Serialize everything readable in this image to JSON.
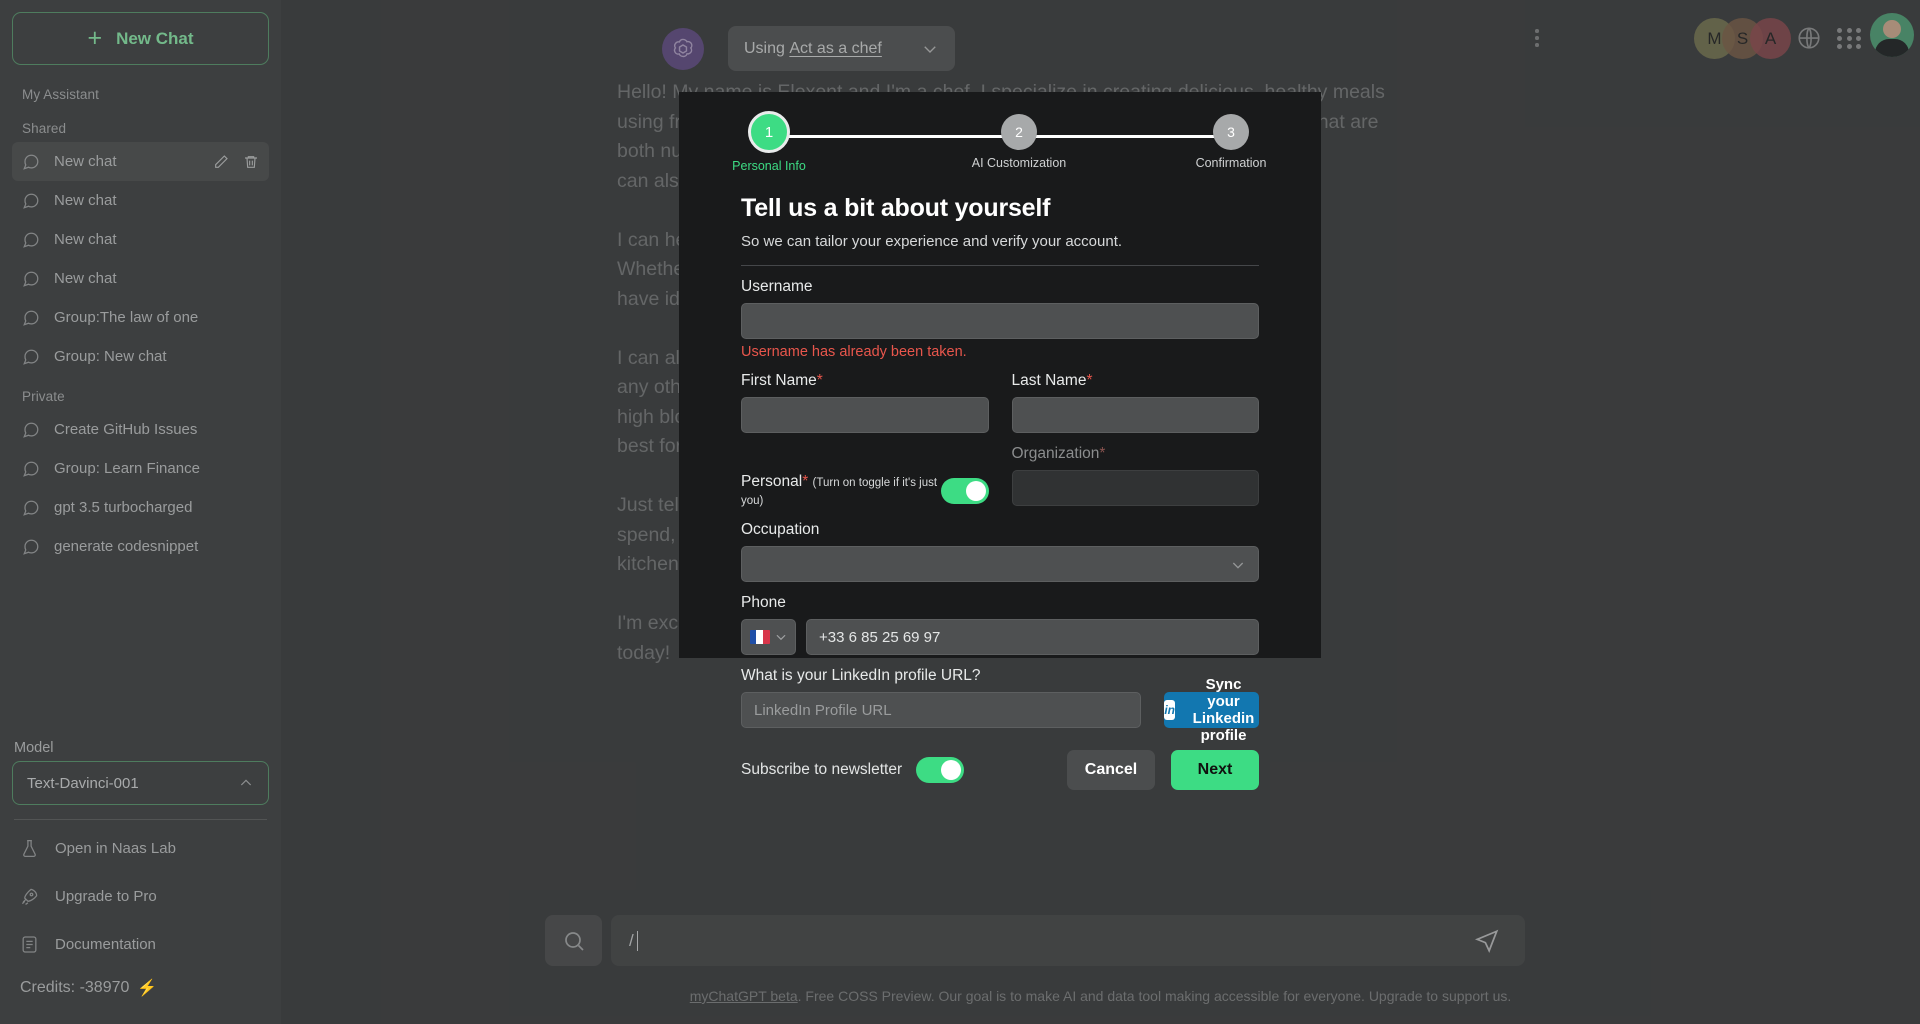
{
  "sidebar": {
    "new_chat_label": "New Chat",
    "sections": [
      {
        "label": "My Assistant"
      },
      {
        "label": "Shared"
      },
      {
        "label": "Private"
      }
    ],
    "shared_chats": [
      {
        "title": "New chat",
        "active": true
      },
      {
        "title": "New chat",
        "active": false
      },
      {
        "title": "New chat",
        "active": false
      },
      {
        "title": "New chat",
        "active": false
      },
      {
        "title": "Group:The law of one",
        "active": false
      },
      {
        "title": "Group: New chat",
        "active": false
      }
    ],
    "private_chats": [
      {
        "title": "Create GitHub Issues"
      },
      {
        "title": "Group: Learn Finance"
      },
      {
        "title": "gpt 3.5 turbocharged"
      },
      {
        "title": "generate codesnippet"
      }
    ],
    "model_label": "Model",
    "model_value": "Text-Davinci-001",
    "links": [
      {
        "label": "Open in Naas Lab",
        "icon": "flask-icon"
      },
      {
        "label": "Upgrade to Pro",
        "icon": "rocket-icon"
      },
      {
        "label": "Documentation",
        "icon": "document-icon"
      }
    ],
    "credits_label": "Credits: -38970"
  },
  "topbar": {
    "using_prefix": "Using",
    "using_value": "Act as a chef",
    "avatars": [
      {
        "initial": "M",
        "color": "#8a8a62"
      },
      {
        "initial": "S",
        "color": "#8a6d57"
      },
      {
        "initial": "A",
        "color": "#9c5a5f"
      }
    ]
  },
  "background_chat": {
    "text": "Hello! My name is Elexent and I'm a chef. I specialize in creating delicious, healthy meals\nusing fresh, locally sourced ingredients. I'm passionate about finding ingredients that are\nboth nutritious and flavorful, and I love helping people discover how healthy food\ncan also taste amazing.\n\nI can help you plan meals, suggest recipes, and advise on your dietary habits.\nWhether you need a quick weeknight dinner or a full week of prep, I\nhave ideas that fit your schedule, your budget, and your taste.\n\nI can also adapt recipes for allergies, vegetarian or vegan diets, or\nany other restrictions you may have. If you're managing diabetes,\nhigh blood pressure, or cholesterol, I can tailor suggestions to what's\nbest for you.\n\nJust tell me what ingredients you have on hand and what you can\nspend, and we'll build something great. Also let me know what\nkitchen equipment you have available.\n\nI'm excited to get started. Let's make something delicious together\ntoday!"
  },
  "composer": {
    "value": "/",
    "footnote_link": "myChatGPT beta",
    "footnote_rest": ". Free COSS Preview. Our goal is to make AI and data tool making accessible for everyone. Upgrade to support us."
  },
  "modal": {
    "steps": [
      {
        "number": "1",
        "label": "Personal Info",
        "active": true
      },
      {
        "number": "2",
        "label": "AI Customization",
        "active": false
      },
      {
        "number": "3",
        "label": "Confirmation",
        "active": false
      }
    ],
    "title": "Tell us a bit about yourself",
    "subtitle": "So we can tailor your experience and verify your account.",
    "username": {
      "label": "Username",
      "value": "",
      "placeholder": "",
      "error": "Username has already been taken."
    },
    "first_name": {
      "label": "First Name",
      "required_mark": "*",
      "value": "",
      "placeholder": ""
    },
    "last_name": {
      "label": "Last Name",
      "required_mark": "*",
      "value": "",
      "placeholder": ""
    },
    "personal": {
      "label": "Personal",
      "required_mark": "*",
      "hint": "(Turn on toggle if it's just you)",
      "enabled": true
    },
    "organization": {
      "label": "Organization",
      "required_mark": "*",
      "value": "",
      "placeholder": ""
    },
    "occupation": {
      "label": "Occupation",
      "value": "",
      "placeholder": ""
    },
    "phone": {
      "label": "Phone",
      "country": "FR",
      "value": "+33 6 85 25 69 97",
      "placeholder": ""
    },
    "linkedin": {
      "label": "What is your LinkedIn profile URL?",
      "value": "",
      "placeholder": "LinkedIn Profile URL",
      "sync_button": "Sync your Linkedin profile"
    },
    "newsletter": {
      "label": "Subscribe to newsletter",
      "enabled": true
    },
    "cancel_label": "Cancel",
    "next_label": "Next",
    "accent_green": "#3ddc84",
    "error_red": "#e8564c",
    "linkedin_blue": "#1277b0"
  }
}
